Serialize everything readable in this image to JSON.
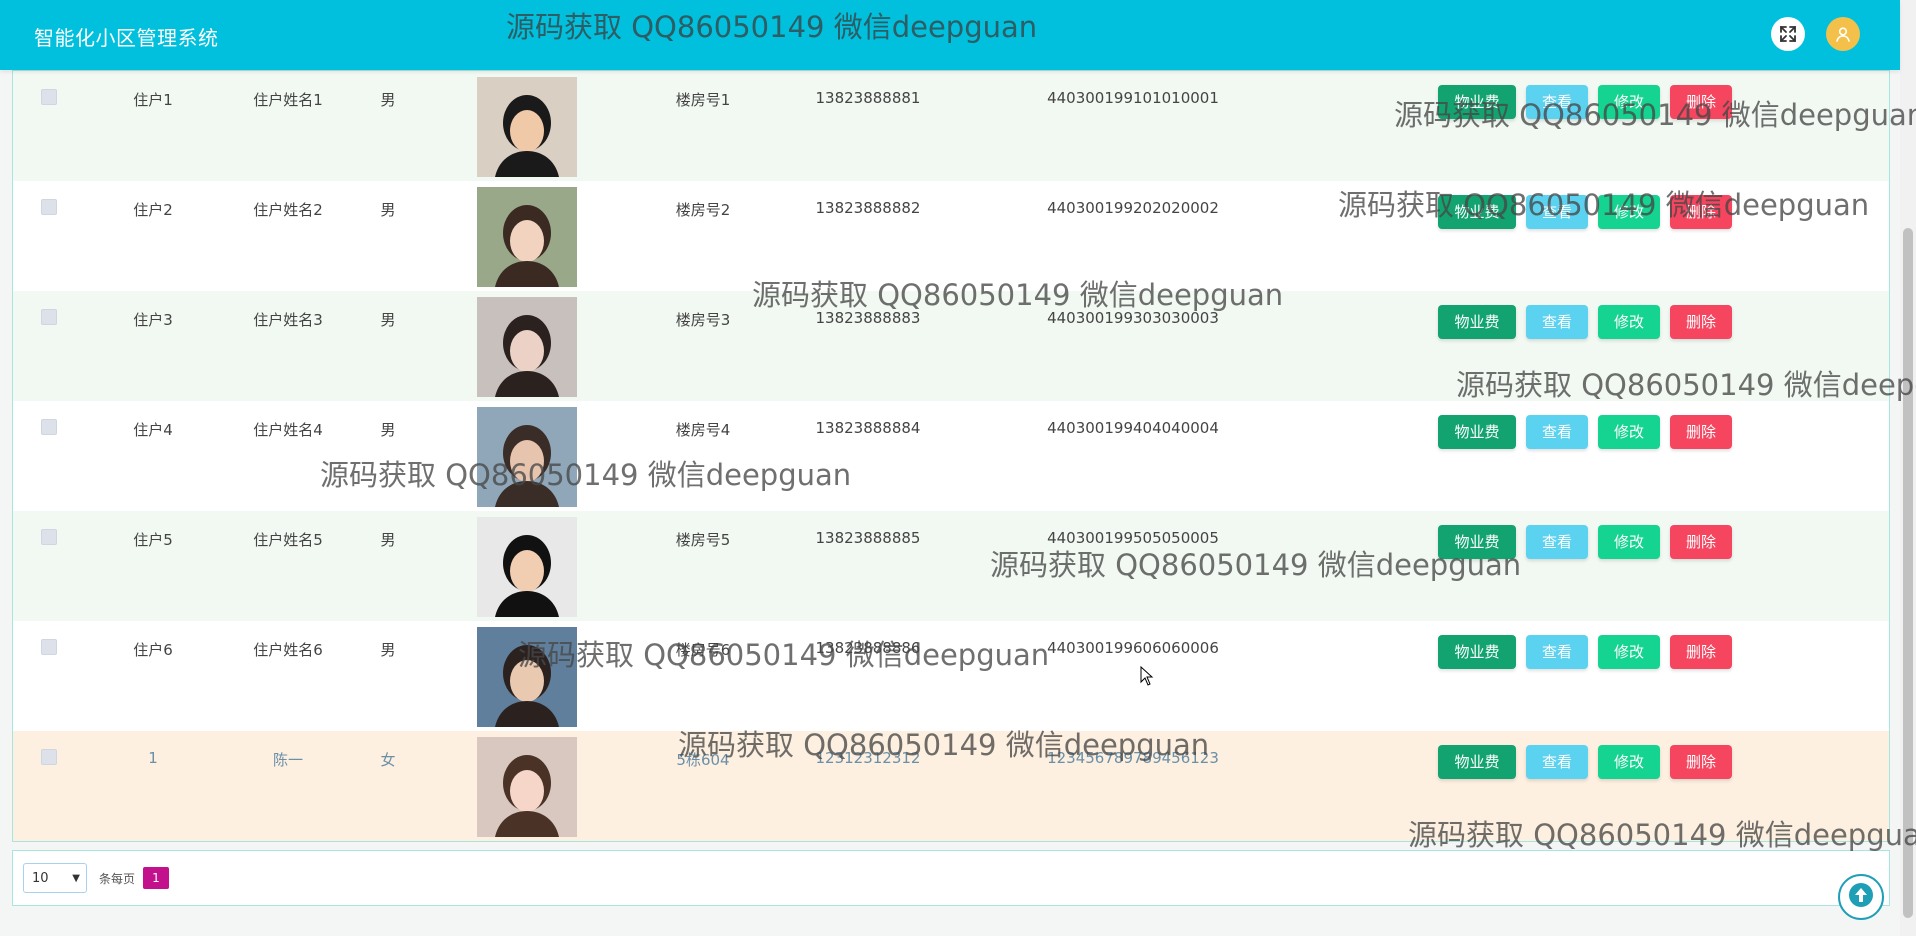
{
  "header": {
    "app_title": "智能化小区管理系统",
    "fullscreen_icon": "fullscreen-icon",
    "user_icon": "user-avatar-icon"
  },
  "table": {
    "action_labels": {
      "fee": "物业费",
      "view": "查看",
      "edit": "修改",
      "delete": "删除"
    },
    "rows": [
      {
        "id": "住户1",
        "name": "住户姓名1",
        "gender": "男",
        "building": "楼房号1",
        "phone": "13823888881",
        "id_number": "440300199101010001"
      },
      {
        "id": "住户2",
        "name": "住户姓名2",
        "gender": "男",
        "building": "楼房号2",
        "phone": "13823888882",
        "id_number": "440300199202020002"
      },
      {
        "id": "住户3",
        "name": "住户姓名3",
        "gender": "男",
        "building": "楼房号3",
        "phone": "13823888883",
        "id_number": "440300199303030003"
      },
      {
        "id": "住户4",
        "name": "住户姓名4",
        "gender": "男",
        "building": "楼房号4",
        "phone": "13823888884",
        "id_number": "440300199404040004"
      },
      {
        "id": "住户5",
        "name": "住户姓名5",
        "gender": "男",
        "building": "楼房号5",
        "phone": "13823888885",
        "id_number": "440300199505050005"
      },
      {
        "id": "住户6",
        "name": "住户姓名6",
        "gender": "男",
        "building": "楼房号6",
        "phone": "13823888886",
        "id_number": "440300199606060006"
      },
      {
        "id": "1",
        "name": "陈一",
        "gender": "女",
        "building": "5栋604",
        "phone": "12312312312",
        "id_number": "123456789789456123"
      }
    ]
  },
  "pagination": {
    "page_size": "10",
    "per_page_label": "条每页",
    "current_page": "1"
  },
  "watermark_text": "源码获取 QQ86050149 微信deepguan",
  "colors": {
    "header_bg": "#00c0dd",
    "fee_button": "#13a371",
    "view_button": "#5bd2f0",
    "edit_button": "#15d491",
    "delete_button": "#f5455f",
    "page_active": "#c3118d",
    "highlight_row": "#fdf0e0"
  }
}
